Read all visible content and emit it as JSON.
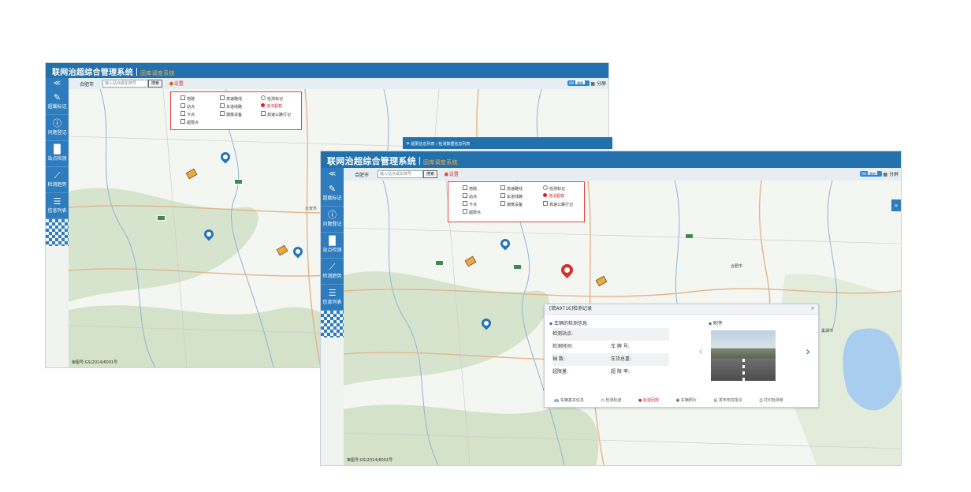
{
  "app": {
    "title": "联网治超综合管理系统",
    "subtitle": "固库调度系统"
  },
  "toolbar": {
    "city": "合肥市",
    "search_placeholder": "输入站点或车牌号",
    "search_btn": "搜索",
    "settings": "设置",
    "on_label": "ON",
    "toggle_label": "图层",
    "layout": "分屏"
  },
  "sidebar": {
    "items": [
      {
        "label": "超载标记",
        "icon": "edit-icon"
      },
      {
        "label": "问题登记",
        "icon": "question-icon"
      },
      {
        "label": "站点检测",
        "icon": "bar-chart-icon"
      },
      {
        "label": "检测趋势",
        "icon": "trend-icon"
      },
      {
        "label": "信息列表",
        "icon": "list-icon"
      }
    ]
  },
  "legend": {
    "items": [
      "地磅",
      "站点",
      "卡点",
      "超限点",
      "高速路线",
      "车道线路",
      "摄像设备",
      "检测标记",
      "违法超载",
      "高速公路行记"
    ]
  },
  "map": {
    "copyright": "审图号:GS(2014)6001号",
    "places": [
      "六安市",
      "合肥市",
      "巢湖市"
    ]
  },
  "subwin": {
    "breadcrumb": "超限信息列表 / 检测数据信息列表"
  },
  "popup": {
    "title": "[皖A9716]检测记录",
    "close": "×",
    "section_vehicle": "车辆的检测信息",
    "section_photo": "附件",
    "rows": [
      {
        "l1": "检测站点:",
        "l2": "",
        "v1": "",
        "v2": ""
      },
      {
        "l1": "检测时间:",
        "l2": "车 牌 号:",
        "v1": "",
        "v2": ""
      },
      {
        "l1": "轴    数:",
        "l2": "车货总重:",
        "v1": "",
        "v2": ""
      },
      {
        "l1": "超限量:",
        "l2": "超 限 率:",
        "v1": "",
        "v2": ""
      }
    ],
    "actions": [
      "车辆基本信息",
      "检测轨迹",
      "轨迹回放",
      "车辆照片",
      "发布布控指令",
      "打印检测单"
    ]
  }
}
